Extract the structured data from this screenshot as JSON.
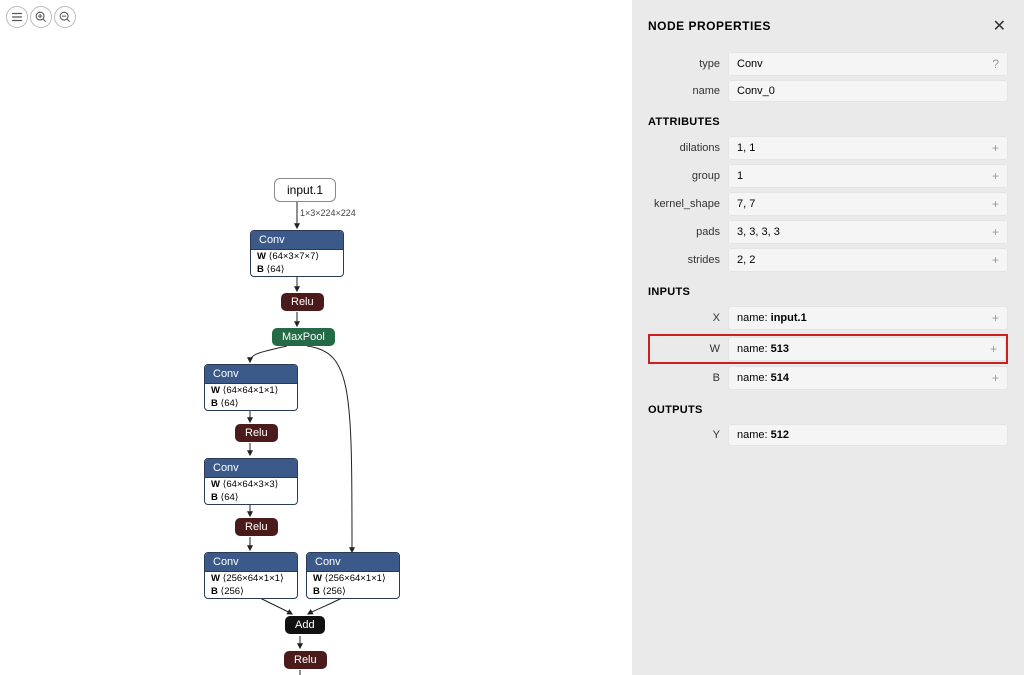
{
  "panel": {
    "title": "NODE PROPERTIES",
    "close": "✕",
    "type_label": "type",
    "type_value": "Conv",
    "name_label": "name",
    "name_value": "Conv_0",
    "attributes_title": "ATTRIBUTES",
    "attributes": [
      {
        "label": "dilations",
        "value": "1, 1"
      },
      {
        "label": "group",
        "value": "1"
      },
      {
        "label": "kernel_shape",
        "value": "7, 7"
      },
      {
        "label": "pads",
        "value": "3, 3, 3, 3"
      },
      {
        "label": "strides",
        "value": "2, 2"
      }
    ],
    "inputs_title": "INPUTS",
    "inputs": [
      {
        "label": "X",
        "prefix": "name: ",
        "value": "input.1",
        "hl": false
      },
      {
        "label": "W",
        "prefix": "name: ",
        "value": "513",
        "hl": true
      },
      {
        "label": "B",
        "prefix": "name: ",
        "value": "514",
        "hl": false
      }
    ],
    "outputs_title": "OUTPUTS",
    "outputs": [
      {
        "label": "Y",
        "prefix": "name: ",
        "value": "512"
      }
    ]
  },
  "graph": {
    "input_label": "input.1",
    "input_shape": "1×3×224×224",
    "conv1": {
      "hdr": "Conv",
      "w": "⟨64×3×7×7⟩",
      "b": "⟨64⟩"
    },
    "conv2": {
      "hdr": "Conv",
      "w": "⟨64×64×1×1⟩",
      "b": "⟨64⟩"
    },
    "conv3": {
      "hdr": "Conv",
      "w": "⟨64×64×3×3⟩",
      "b": "⟨64⟩"
    },
    "conv4": {
      "hdr": "Conv",
      "w": "⟨256×64×1×1⟩",
      "b": "⟨256⟩"
    },
    "conv5": {
      "hdr": "Conv",
      "w": "⟨256×64×1×1⟩",
      "b": "⟨256⟩"
    },
    "relu": "Relu",
    "maxpool": "MaxPool",
    "add": "Add"
  }
}
